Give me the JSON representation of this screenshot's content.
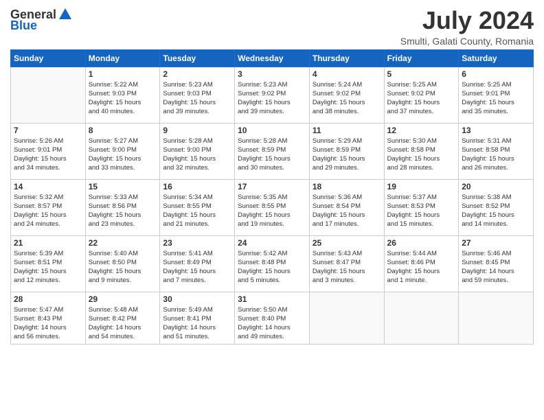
{
  "header": {
    "logo_general": "General",
    "logo_blue": "Blue",
    "month_year": "July 2024",
    "location": "Smulti, Galati County, Romania"
  },
  "weekdays": [
    "Sunday",
    "Monday",
    "Tuesday",
    "Wednesday",
    "Thursday",
    "Friday",
    "Saturday"
  ],
  "rows": [
    [
      {
        "day": "",
        "info": ""
      },
      {
        "day": "1",
        "info": "Sunrise: 5:22 AM\nSunset: 9:03 PM\nDaylight: 15 hours\nand 40 minutes."
      },
      {
        "day": "2",
        "info": "Sunrise: 5:23 AM\nSunset: 9:03 PM\nDaylight: 15 hours\nand 39 minutes."
      },
      {
        "day": "3",
        "info": "Sunrise: 5:23 AM\nSunset: 9:02 PM\nDaylight: 15 hours\nand 39 minutes."
      },
      {
        "day": "4",
        "info": "Sunrise: 5:24 AM\nSunset: 9:02 PM\nDaylight: 15 hours\nand 38 minutes."
      },
      {
        "day": "5",
        "info": "Sunrise: 5:25 AM\nSunset: 9:02 PM\nDaylight: 15 hours\nand 37 minutes."
      },
      {
        "day": "6",
        "info": "Sunrise: 5:25 AM\nSunset: 9:01 PM\nDaylight: 15 hours\nand 35 minutes."
      }
    ],
    [
      {
        "day": "7",
        "info": "Sunrise: 5:26 AM\nSunset: 9:01 PM\nDaylight: 15 hours\nand 34 minutes."
      },
      {
        "day": "8",
        "info": "Sunrise: 5:27 AM\nSunset: 9:00 PM\nDaylight: 15 hours\nand 33 minutes."
      },
      {
        "day": "9",
        "info": "Sunrise: 5:28 AM\nSunset: 9:00 PM\nDaylight: 15 hours\nand 32 minutes."
      },
      {
        "day": "10",
        "info": "Sunrise: 5:28 AM\nSunset: 8:59 PM\nDaylight: 15 hours\nand 30 minutes."
      },
      {
        "day": "11",
        "info": "Sunrise: 5:29 AM\nSunset: 8:59 PM\nDaylight: 15 hours\nand 29 minutes."
      },
      {
        "day": "12",
        "info": "Sunrise: 5:30 AM\nSunset: 8:58 PM\nDaylight: 15 hours\nand 28 minutes."
      },
      {
        "day": "13",
        "info": "Sunrise: 5:31 AM\nSunset: 8:58 PM\nDaylight: 15 hours\nand 26 minutes."
      }
    ],
    [
      {
        "day": "14",
        "info": "Sunrise: 5:32 AM\nSunset: 8:57 PM\nDaylight: 15 hours\nand 24 minutes."
      },
      {
        "day": "15",
        "info": "Sunrise: 5:33 AM\nSunset: 8:56 PM\nDaylight: 15 hours\nand 23 minutes."
      },
      {
        "day": "16",
        "info": "Sunrise: 5:34 AM\nSunset: 8:55 PM\nDaylight: 15 hours\nand 21 minutes."
      },
      {
        "day": "17",
        "info": "Sunrise: 5:35 AM\nSunset: 8:55 PM\nDaylight: 15 hours\nand 19 minutes."
      },
      {
        "day": "18",
        "info": "Sunrise: 5:36 AM\nSunset: 8:54 PM\nDaylight: 15 hours\nand 17 minutes."
      },
      {
        "day": "19",
        "info": "Sunrise: 5:37 AM\nSunset: 8:53 PM\nDaylight: 15 hours\nand 15 minutes."
      },
      {
        "day": "20",
        "info": "Sunrise: 5:38 AM\nSunset: 8:52 PM\nDaylight: 15 hours\nand 14 minutes."
      }
    ],
    [
      {
        "day": "21",
        "info": "Sunrise: 5:39 AM\nSunset: 8:51 PM\nDaylight: 15 hours\nand 12 minutes."
      },
      {
        "day": "22",
        "info": "Sunrise: 5:40 AM\nSunset: 8:50 PM\nDaylight: 15 hours\nand 9 minutes."
      },
      {
        "day": "23",
        "info": "Sunrise: 5:41 AM\nSunset: 8:49 PM\nDaylight: 15 hours\nand 7 minutes."
      },
      {
        "day": "24",
        "info": "Sunrise: 5:42 AM\nSunset: 8:48 PM\nDaylight: 15 hours\nand 5 minutes."
      },
      {
        "day": "25",
        "info": "Sunrise: 5:43 AM\nSunset: 8:47 PM\nDaylight: 15 hours\nand 3 minutes."
      },
      {
        "day": "26",
        "info": "Sunrise: 5:44 AM\nSunset: 8:46 PM\nDaylight: 15 hours\nand 1 minute."
      },
      {
        "day": "27",
        "info": "Sunrise: 5:46 AM\nSunset: 8:45 PM\nDaylight: 14 hours\nand 59 minutes."
      }
    ],
    [
      {
        "day": "28",
        "info": "Sunrise: 5:47 AM\nSunset: 8:43 PM\nDaylight: 14 hours\nand 56 minutes."
      },
      {
        "day": "29",
        "info": "Sunrise: 5:48 AM\nSunset: 8:42 PM\nDaylight: 14 hours\nand 54 minutes."
      },
      {
        "day": "30",
        "info": "Sunrise: 5:49 AM\nSunset: 8:41 PM\nDaylight: 14 hours\nand 51 minutes."
      },
      {
        "day": "31",
        "info": "Sunrise: 5:50 AM\nSunset: 8:40 PM\nDaylight: 14 hours\nand 49 minutes."
      },
      {
        "day": "",
        "info": ""
      },
      {
        "day": "",
        "info": ""
      },
      {
        "day": "",
        "info": ""
      }
    ]
  ]
}
